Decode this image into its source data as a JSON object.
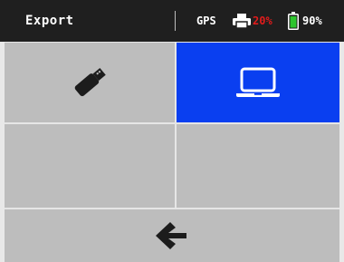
{
  "status_bar": {
    "title": "Export",
    "gps_label": "GPS",
    "printer_percent": "20%",
    "battery_percent": "90%",
    "printer_icon": "printer-icon",
    "battery_icon": "battery-icon",
    "colors": {
      "background": "#1f1f1f",
      "printer_low": "#e01b1b",
      "battery_ok": "#2ec52e"
    }
  },
  "grid": {
    "tiles": [
      {
        "id": "usb",
        "icon": "usb-drive-icon",
        "selected": false
      },
      {
        "id": "laptop",
        "icon": "laptop-icon",
        "selected": true
      },
      {
        "id": "empty-1",
        "icon": "",
        "selected": false
      },
      {
        "id": "empty-2",
        "icon": "",
        "selected": false
      }
    ],
    "colors": {
      "tile": "#bdbdbd",
      "selected": "#0a3ff0"
    }
  },
  "back": {
    "icon": "arrow-left-icon"
  }
}
